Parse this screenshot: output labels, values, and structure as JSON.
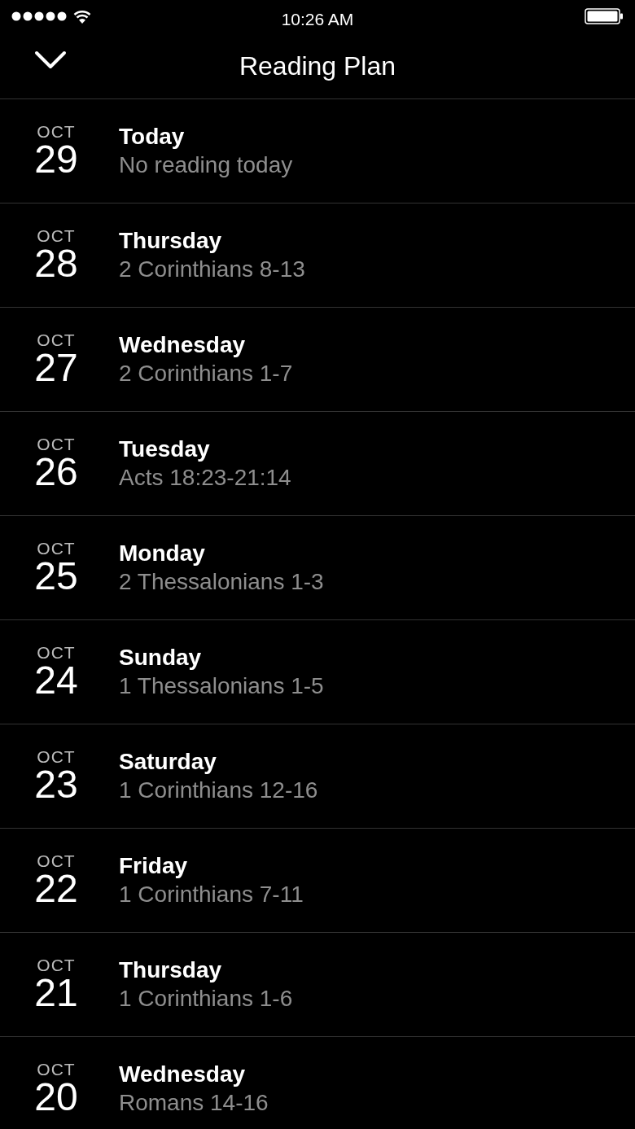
{
  "status_bar": {
    "time": "10:26 AM"
  },
  "header": {
    "title": "Reading Plan"
  },
  "readings": [
    {
      "month": "OCT",
      "day": "29",
      "title": "Today",
      "passage": "No reading today"
    },
    {
      "month": "OCT",
      "day": "28",
      "title": "Thursday",
      "passage": "2 Corinthians 8-13"
    },
    {
      "month": "OCT",
      "day": "27",
      "title": "Wednesday",
      "passage": "2 Corinthians 1-7"
    },
    {
      "month": "OCT",
      "day": "26",
      "title": "Tuesday",
      "passage": "Acts 18:23-21:14"
    },
    {
      "month": "OCT",
      "day": "25",
      "title": "Monday",
      "passage": "2 Thessalonians 1-3"
    },
    {
      "month": "OCT",
      "day": "24",
      "title": "Sunday",
      "passage": "1 Thessalonians 1-5"
    },
    {
      "month": "OCT",
      "day": "23",
      "title": "Saturday",
      "passage": "1 Corinthians 12-16"
    },
    {
      "month": "OCT",
      "day": "22",
      "title": "Friday",
      "passage": "1 Corinthians 7-11"
    },
    {
      "month": "OCT",
      "day": "21",
      "title": "Thursday",
      "passage": "1 Corinthians 1-6"
    },
    {
      "month": "OCT",
      "day": "20",
      "title": "Wednesday",
      "passage": "Romans 14-16"
    }
  ]
}
